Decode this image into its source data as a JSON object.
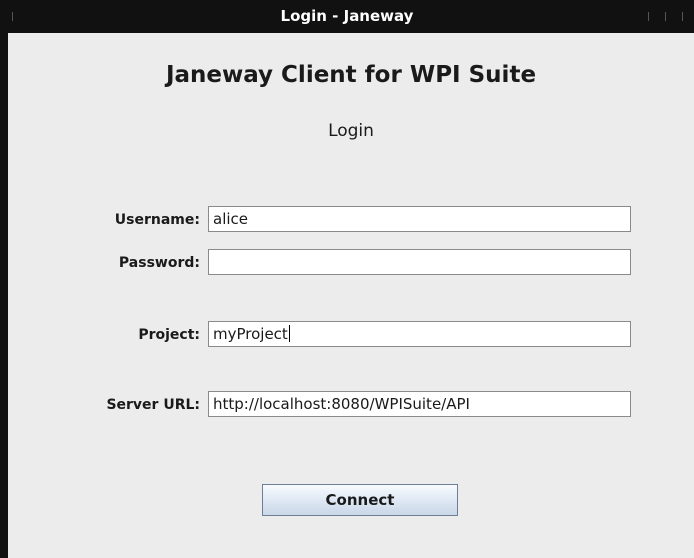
{
  "window": {
    "title": "Login - Janeway"
  },
  "header": {
    "app_title": "Janeway Client for WPI Suite",
    "subtitle": "Login"
  },
  "form": {
    "username": {
      "label": "Username:",
      "value": "alice"
    },
    "password": {
      "label": "Password:",
      "value": ""
    },
    "project": {
      "label": "Project:",
      "value": "myProject"
    },
    "server_url": {
      "label": "Server URL:",
      "value": "http://localhost:8080/WPISuite/API"
    }
  },
  "actions": {
    "connect_label": "Connect"
  }
}
